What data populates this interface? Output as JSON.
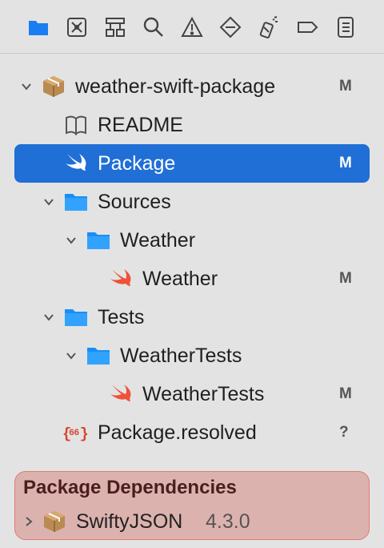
{
  "toolbar": {
    "icons": [
      "folder-icon",
      "source-control-icon",
      "hierarchy-icon",
      "search-icon",
      "warning-icon",
      "breakpoint-diamond-icon",
      "test-spray-icon",
      "tag-icon",
      "report-icon"
    ],
    "accent": "#1a7ef2"
  },
  "tree": {
    "items": [
      {
        "label": "weather-swift-package",
        "badge": "M",
        "icon": "package-icon"
      },
      {
        "label": "README",
        "badge": "",
        "icon": "book-icon"
      },
      {
        "label": "Package",
        "badge": "M",
        "icon": "swift-icon"
      },
      {
        "label": "Sources",
        "badge": "",
        "icon": "folder-icon"
      },
      {
        "label": "Weather",
        "badge": "",
        "icon": "folder-icon"
      },
      {
        "label": "Weather",
        "badge": "M",
        "icon": "swift-icon"
      },
      {
        "label": "Tests",
        "badge": "",
        "icon": "folder-icon"
      },
      {
        "label": "WeatherTests",
        "badge": "",
        "icon": "folder-icon"
      },
      {
        "label": "WeatherTests",
        "badge": "M",
        "icon": "swift-icon"
      },
      {
        "label": "Package.resolved",
        "badge": "?",
        "icon": "json-braces-icon"
      }
    ],
    "selected_index": 2,
    "selection_color": "#1f6fd6"
  },
  "dependencies": {
    "title": "Package Dependencies",
    "items": [
      {
        "name": "SwiftyJSON",
        "version": "4.3.0",
        "icon": "package-icon"
      }
    ],
    "highlight_color": "#dcb2ae"
  }
}
